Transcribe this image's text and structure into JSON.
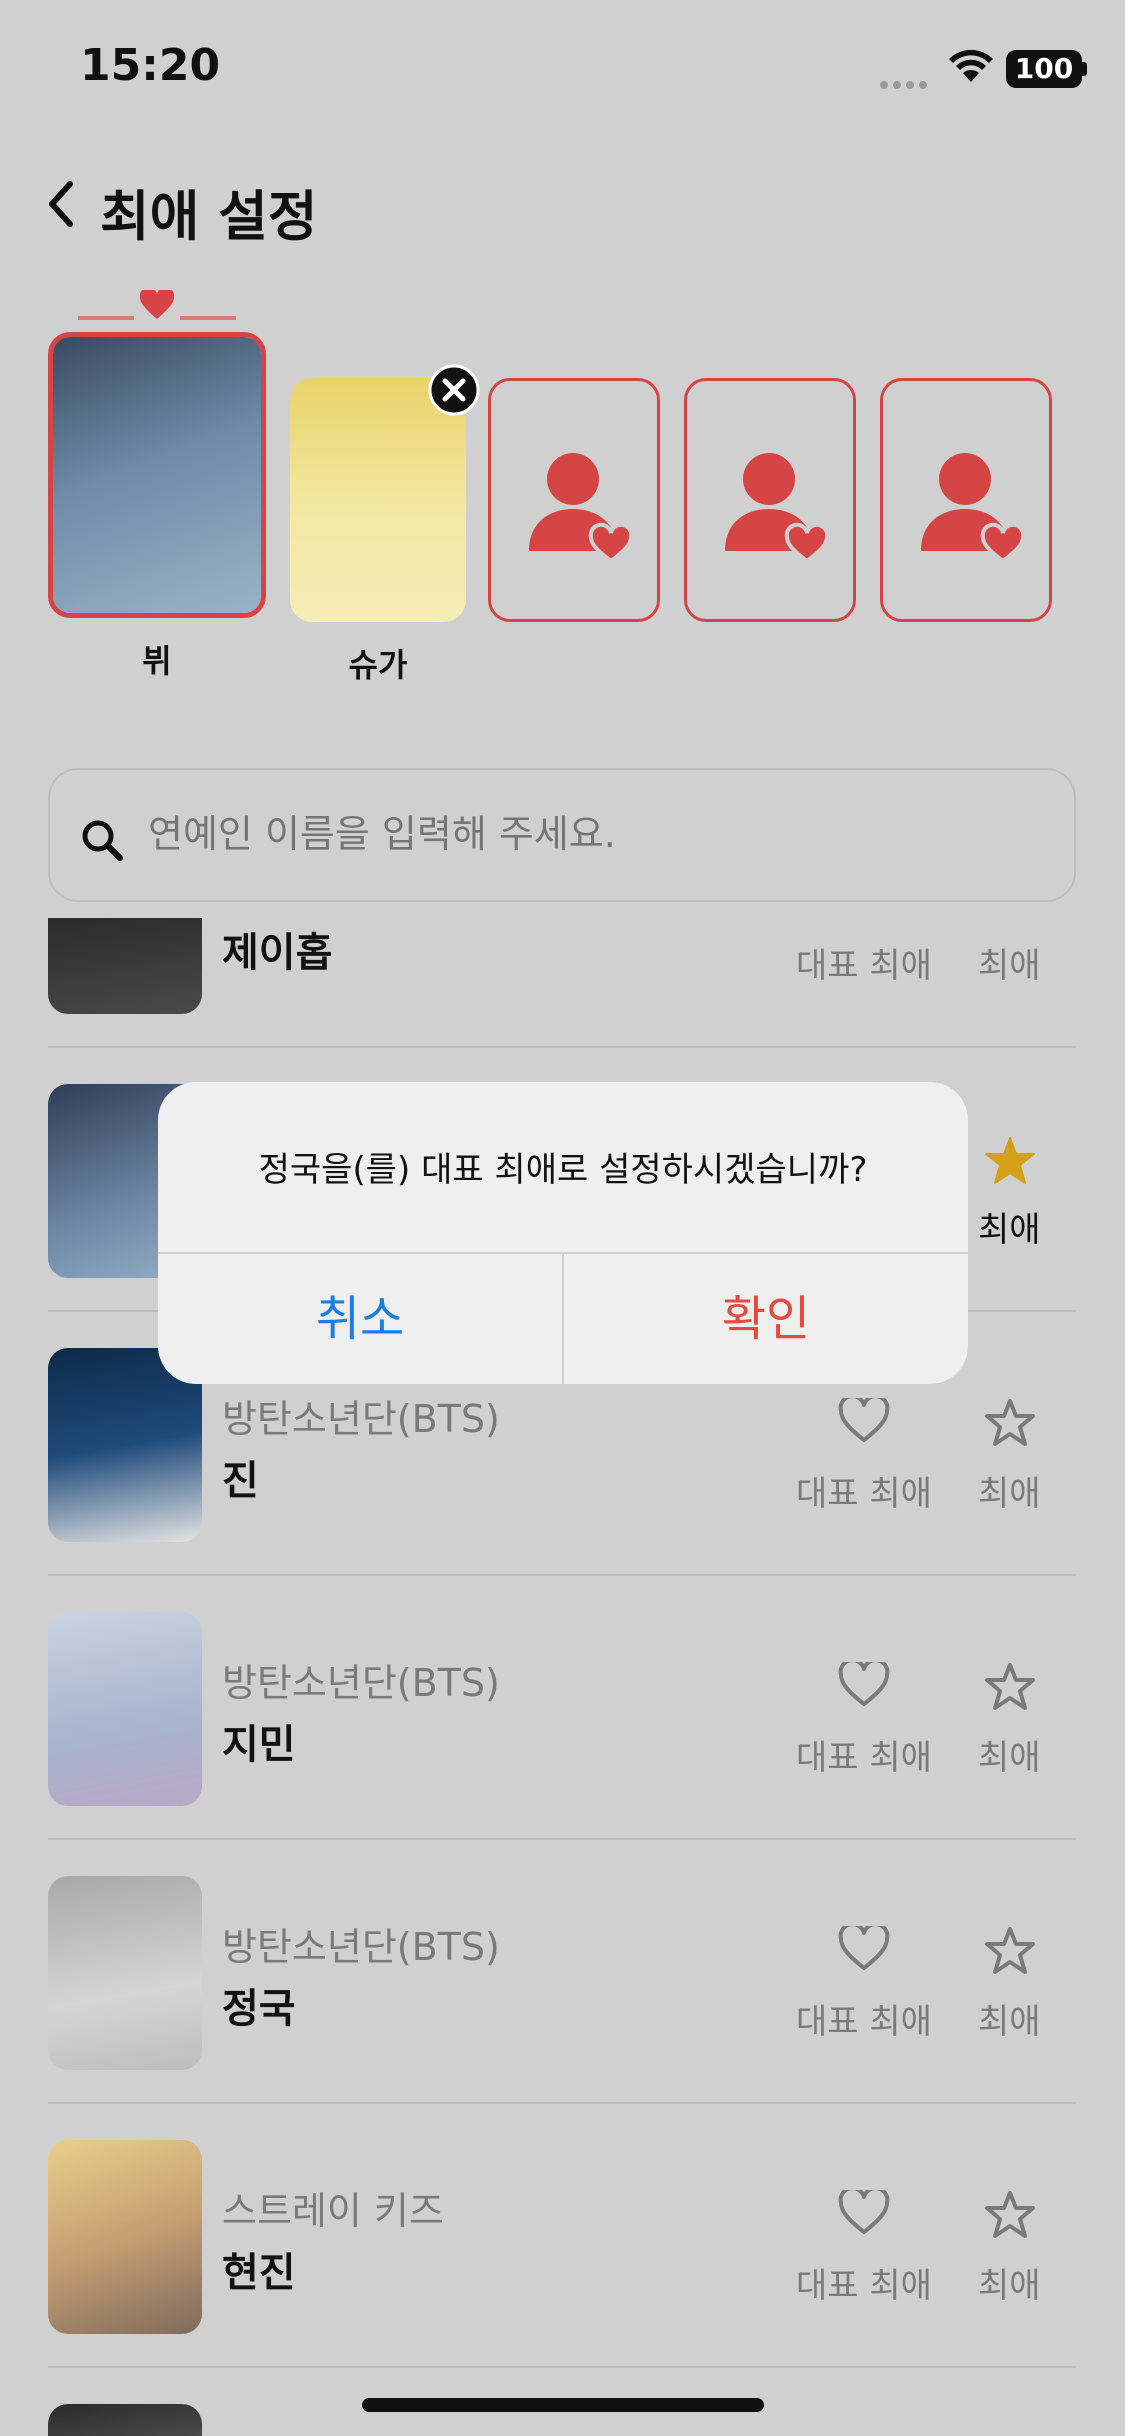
{
  "status": {
    "time": "15:20",
    "battery": "100"
  },
  "header": {
    "title": "최애 설정"
  },
  "bias_slots": [
    {
      "name": "뷔"
    },
    {
      "name": "슈가"
    }
  ],
  "search": {
    "placeholder": "연예인 이름을 입력해 주세요."
  },
  "list": [
    {
      "group": "",
      "name": "제이홉",
      "rep_label": "대표 최애",
      "fav_label": "최애"
    },
    {
      "group": "",
      "name": "",
      "rep_label": "",
      "fav_label": "최애"
    },
    {
      "group": "방탄소년단(BTS)",
      "name": "진",
      "rep_label": "대표 최애",
      "fav_label": "최애"
    },
    {
      "group": "방탄소년단(BTS)",
      "name": "지민",
      "rep_label": "대표 최애",
      "fav_label": "최애"
    },
    {
      "group": "방탄소년단(BTS)",
      "name": "정국",
      "rep_label": "대표 최애",
      "fav_label": "최애"
    },
    {
      "group": "스트레이 키즈",
      "name": "현진",
      "rep_label": "대표 최애",
      "fav_label": "최애"
    }
  ],
  "dialog": {
    "message": "정국을(를) 대표 최애로 설정하시겠습니까?",
    "cancel": "취소",
    "confirm": "확인"
  },
  "colors": {
    "accent": "#d64545",
    "cancel": "#1a7fe0",
    "confirm": "#e34b40",
    "star_active": "#d4a017"
  }
}
